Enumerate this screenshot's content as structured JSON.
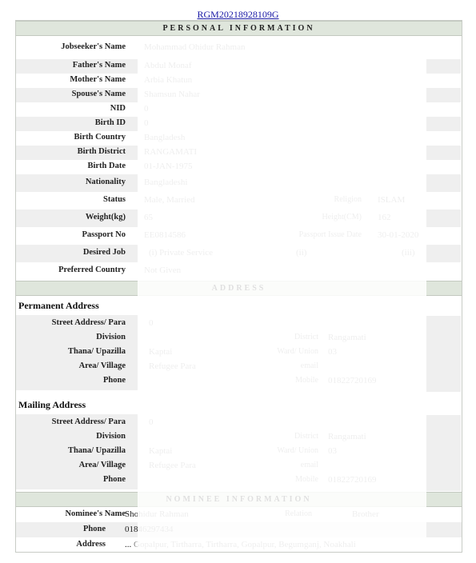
{
  "header": {
    "registration_id": "RGM20218928109G"
  },
  "sections": {
    "personal": "PERSONAL   INFORMATION",
    "address": "ADDRESS",
    "nominee": "NOMINEE   INFORMATION"
  },
  "personal": {
    "jobseeker_name": {
      "label": "Jobseeker's Name",
      "value": "Mohammad Ohidur Rahman"
    },
    "father_name": {
      "label": "Father's Name",
      "value": "Abdul Monaf"
    },
    "mother_name": {
      "label": "Mother's Name",
      "value": "Arbia Khatun"
    },
    "spouse_name": {
      "label": "Spouse's Name",
      "value": "Shamsun Nahar"
    },
    "nid": {
      "label": "NID",
      "value": "0"
    },
    "birth_id": {
      "label": "Birth ID",
      "value": "0"
    },
    "birth_country": {
      "label": "Birth Country",
      "value": "Bangladesh"
    },
    "birth_district": {
      "label": "Birth District",
      "value": "RANGAMATI"
    },
    "birth_date": {
      "label": "Birth Date",
      "value": "01-JAN-1975"
    },
    "nationality": {
      "label": "Nationality",
      "value": "Bangladeshi"
    },
    "status": {
      "label": "Status",
      "value": "Male, Married"
    },
    "religion": {
      "label": "Religion",
      "value": "ISLAM"
    },
    "weight": {
      "label": "Weight(kg)",
      "value": "65"
    },
    "height": {
      "label": "Height(CM)",
      "value": "162"
    },
    "passport_no": {
      "label": "Passport No",
      "value": "EE0814586"
    },
    "passport_issue_date": {
      "label": "Passport Issue Date",
      "value": "30-01-2020"
    },
    "desired_job": {
      "label": "Desired Job",
      "value_1": "(i)   Private Service",
      "value_2": "(ii)",
      "value_3": "(iii)"
    },
    "preferred_country": {
      "label": "Preferred Country",
      "value": "Not Given"
    }
  },
  "permanent_address": {
    "title": "Permanent Address",
    "street": {
      "label": "Street Address/ Para",
      "value": "0"
    },
    "division": {
      "label": "Division",
      "value": ""
    },
    "district": {
      "label": "District",
      "value": "Rangamati"
    },
    "thana": {
      "label": "Thana/ Upazilla",
      "value": "Kaptai"
    },
    "ward": {
      "label": "Ward/ Union",
      "value": "03"
    },
    "area": {
      "label": "Area/ Village",
      "value": "Refugee Para"
    },
    "email": {
      "label": "email",
      "value": ""
    },
    "phone": {
      "label": "Phone",
      "value": ""
    },
    "mobile": {
      "label": "Mobile",
      "value": "01822720169"
    }
  },
  "mailing_address": {
    "title": "Mailing Address",
    "street": {
      "label": "Street Address/ Para",
      "value": "0"
    },
    "division": {
      "label": "Division",
      "value": ""
    },
    "district": {
      "label": "District",
      "value": "Rangamati"
    },
    "thana": {
      "label": "Thana/ Upazilla",
      "value": "Kaptai"
    },
    "ward": {
      "label": "Ward/ Union",
      "value": "03"
    },
    "area": {
      "label": "Area/ Village",
      "value": "Refugee Para"
    },
    "email": {
      "label": "email",
      "value": ""
    },
    "phone": {
      "label": "Phone",
      "value": ""
    },
    "mobile": {
      "label": "Mobile",
      "value": "01822720169"
    }
  },
  "nominee": {
    "name": {
      "label": "Nominee's Name",
      "value_visible": "Sho",
      "value_faded": "hidur Rahman"
    },
    "relation": {
      "label": "Relation",
      "value": "Brother"
    },
    "phone": {
      "label": "Phone",
      "value_visible": "018",
      "value_faded": "46297434"
    },
    "address": {
      "label": "Address",
      "value_visible": "...",
      "value_faded": "Gopalpur, Tirtharra, Tirtharra, Gopalpur, Begumganj, Noakhali"
    }
  }
}
